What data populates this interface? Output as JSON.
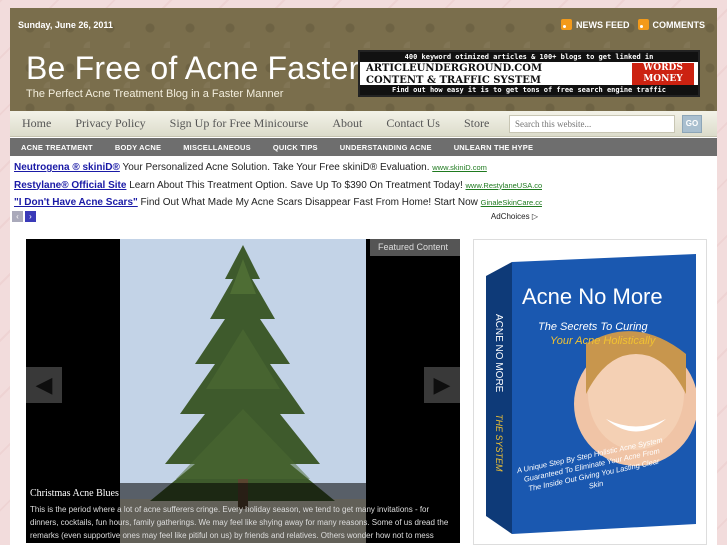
{
  "header": {
    "date": "Sunday, June 26, 2011",
    "feeds": [
      "NEWS FEED",
      "COMMENTS"
    ],
    "site_title": "Be Free of Acne Faster",
    "tagline": "The Perfect Acne Treatment Blog in a Faster Manner",
    "banner": {
      "line1": "400 keyword otimized articles & 100+ blogs to get linked in",
      "line2": "ARTICLEUNDERGROUND.COM",
      "line3": "CONTENT & TRAFFIC SYSTEM",
      "badge": "WORDS MONEY",
      "line4": "Find out how easy it is to get tons of free search engine traffic"
    }
  },
  "nav": {
    "items": [
      "Home",
      "Privacy Policy",
      "Sign Up for Free Minicourse",
      "About",
      "Contact Us",
      "Store"
    ],
    "search_placeholder": "Search this website...",
    "go_label": "GO"
  },
  "subnav": {
    "items": [
      "ACNE TREATMENT",
      "BODY ACNE",
      "MISCELLANEOUS",
      "QUICK TIPS",
      "UNDERSTANDING ACNE",
      "UNLEARN THE HYPE"
    ]
  },
  "ads": {
    "items": [
      {
        "title": "Neutrogena ® skiniD®",
        "text": " Your Personalized Acne Solution. Take Your Free skiniD® Evaluation. ",
        "url": "www.skiniD.com"
      },
      {
        "title": "Restylane® Official Site",
        "text": " Learn About This Treatment Option. Save Up To $390 On Treatment Today! ",
        "url": "www.RestylaneUSA.com"
      },
      {
        "title": "\"I Don't Have Acne Scars\"",
        "text": " Find Out What Made My Acne Scars Disappear Fast From Home! Start Now ",
        "url": "GinaleSkinCare.com/No"
      }
    ],
    "adchoices": "AdChoices"
  },
  "featured": {
    "label": "Featured Content",
    "title": "Christmas Acne Blues",
    "text": "This is the period where a lot of acne sufferers cringe. Every holiday season, we tend to get many invitations - for dinners, cocktails, fun hours, family gatherings. We may feel like shying away for many reasons. Some of us dread the remarks (even supportive ones may feel like pitiful on us) by friends and relatives. Others wonder how not to mess"
  },
  "sidebar": {
    "book_title": "Acne No More",
    "book_sub1": "The Secrets To Curing",
    "book_sub2": "Your Acne Holistically",
    "book_spine": "ACNE NO MORE",
    "book_spine2": "THE SYSTEM",
    "book_blurb": "A Unique Step By Step Holistic Acne System Guaranteed To Eliminate Your Acne From The Inside Out Giving You Lasting Clear Skin",
    "colors": {
      "cover_blue": "#1a58b0",
      "accent": "#f1c232"
    }
  }
}
